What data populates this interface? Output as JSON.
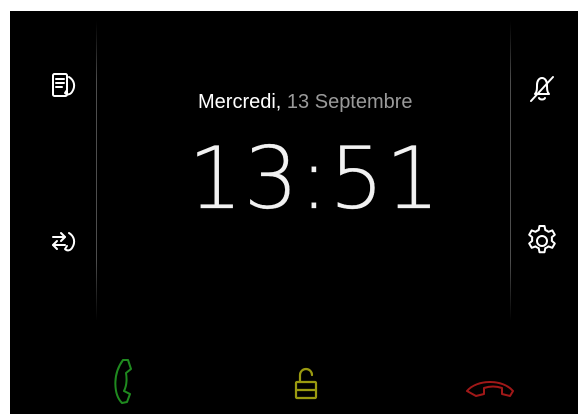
{
  "clock_screen": {
    "date": {
      "weekday": "Mercredi",
      "separator": ",",
      "day_month": "13 Septembre"
    },
    "time": "13:51"
  },
  "left_panel": {
    "icons": [
      "call-log-icon",
      "call-transfer-icon"
    ]
  },
  "right_panel": {
    "icons": [
      "bell-off-icon",
      "gear-icon"
    ]
  },
  "bottom_bar": {
    "buttons": [
      {
        "icon": "phone-answer-icon",
        "color": "#1f8a1f"
      },
      {
        "icon": "unlock-icon",
        "color": "#9a9a10"
      },
      {
        "icon": "phone-hangup-icon",
        "color": "#a01818"
      }
    ]
  },
  "colors": {
    "background": "#000000",
    "text_primary": "#ffffff",
    "text_secondary": "#9a9a9a"
  }
}
